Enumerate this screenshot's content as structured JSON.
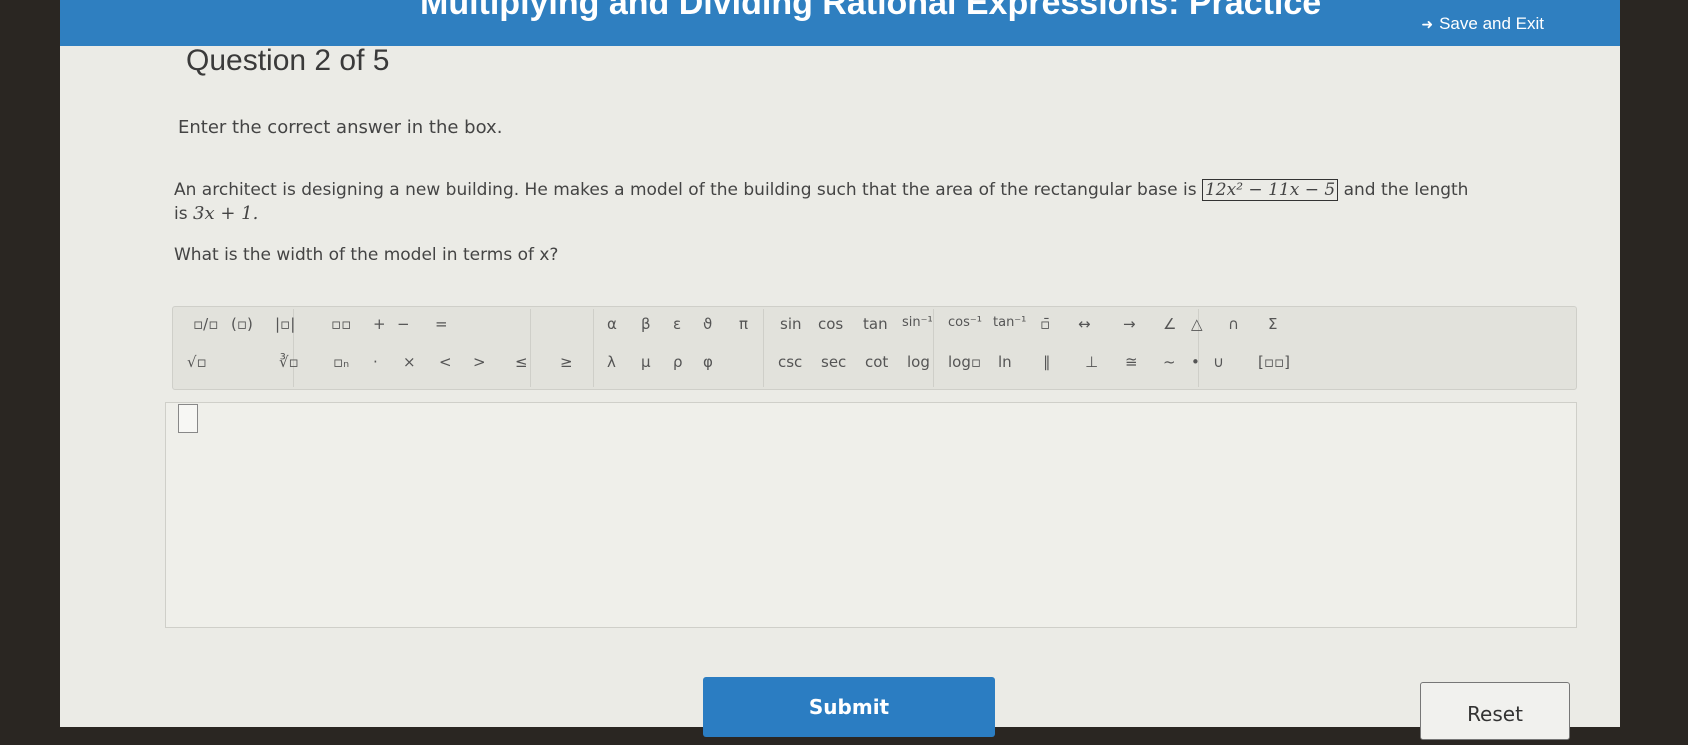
{
  "header": {
    "title": "Multiplying and Dividing Rational Expressions: Practice",
    "save_exit": "Save and Exit"
  },
  "question": {
    "counter": "Question 2 of 5",
    "instruction": "Enter the correct answer in the box.",
    "prompt_part1": "An architect is designing a new building. He makes a model of the building such that the area of the rectangular base is",
    "area_expr": "12x² − 11x − 5",
    "prompt_part2": "and the length",
    "prompt_part3": "is",
    "length_expr": "3x + 1.",
    "ask": "What is the width of the model in terms of x?"
  },
  "toolbar": {
    "row1": [
      "▫/▫",
      "(▫)",
      "|▫|",
      "▫▫",
      "+",
      "−",
      "=",
      "α",
      "β",
      "ε",
      "ϑ",
      "π",
      "sin",
      "cos",
      "tan",
      "sin⁻¹",
      "cos⁻¹",
      "tan⁻¹",
      "▫̄",
      "↔",
      "→",
      "∠",
      "△",
      "∩",
      "Σ"
    ],
    "row2": [
      "√▫",
      "∛▫",
      "▫ₙ",
      "·",
      "×",
      "<",
      ">",
      "≤",
      "≥",
      "λ",
      "μ",
      "ρ",
      "φ",
      "csc",
      "sec",
      "cot",
      "log",
      "log▫",
      "ln",
      "∥",
      "⊥",
      "≅",
      "~",
      "•",
      "∪",
      "[▫▫]"
    ]
  },
  "buttons": {
    "submit": "Submit",
    "reset": "Reset"
  }
}
